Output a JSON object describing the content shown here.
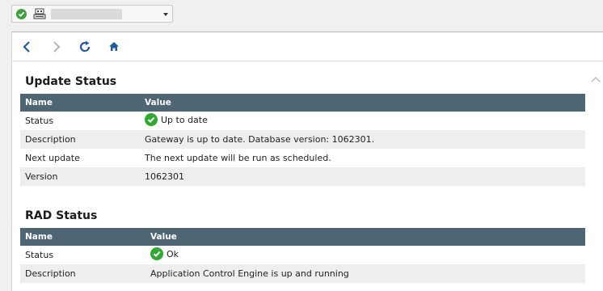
{
  "nav": {
    "back": "back-arrow",
    "forward": "forward-arrow",
    "refresh": "refresh",
    "home": "home"
  },
  "update_status": {
    "title": "Update Status",
    "columns": [
      "Name",
      "Value"
    ],
    "rows": [
      {
        "name": "Status",
        "value": "Up to date"
      },
      {
        "name": "Description",
        "value": "Gateway is up to date. Database version: 1062301."
      },
      {
        "name": "Next update",
        "value": "The next update will be run as scheduled."
      },
      {
        "name": "Version",
        "value": "1062301"
      }
    ]
  },
  "rad_status": {
    "title": "RAD Status",
    "columns": [
      "Name",
      "Value"
    ],
    "rows": [
      {
        "name": "Status",
        "value": "Ok"
      },
      {
        "name": "Description",
        "value": "Application Control Engine is up and running"
      }
    ]
  },
  "colors": {
    "header_bg": "#4e6573",
    "ok_green": "#2eaa2e",
    "nav_blue": "#1f5aa6"
  }
}
